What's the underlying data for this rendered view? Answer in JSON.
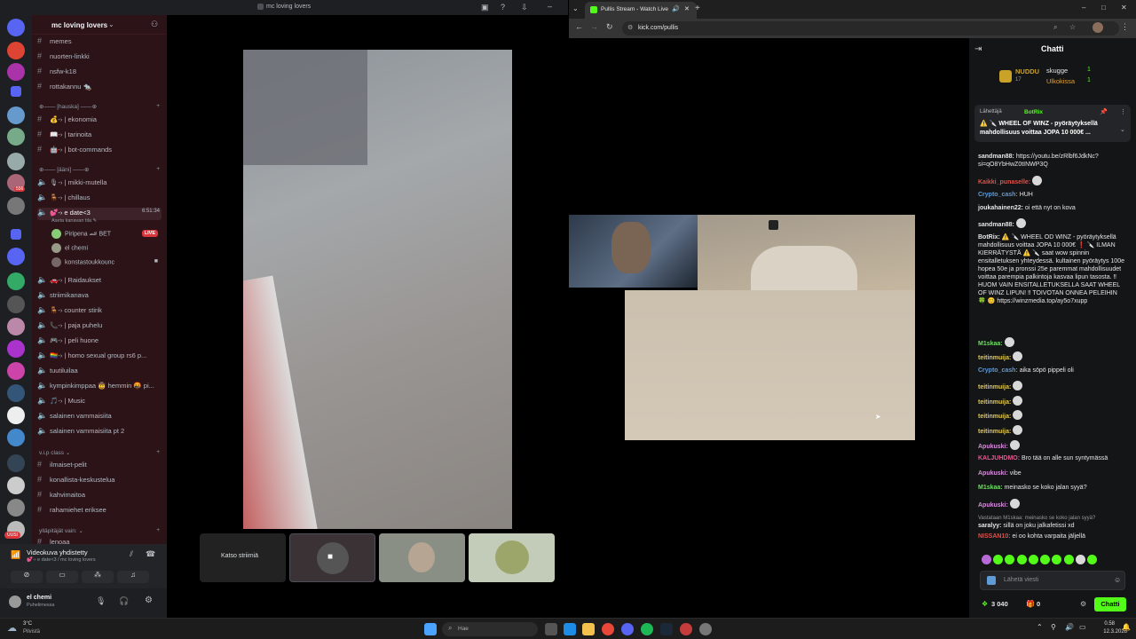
{
  "discord": {
    "window_title": "mc loving lovers",
    "server_name": "mc loving lovers",
    "channels_top": [
      "memes",
      "nuorten-linkki",
      "nsfw-k18",
      "rottakannu 🐀"
    ],
    "category_hauska": "⊕—— [hauska] ——⊕",
    "channels_hauska": [
      "💰-› | ekonomia",
      "📖-› | tarinoita",
      "🤖-› | bot-commands"
    ],
    "category_aani": "⊕—— [ääni] ——⊕",
    "voice_channels_a": [
      "🎙-› | mikki-mutella",
      "🪑-› | chillaus",
      "💕-› e date<3"
    ],
    "active_voice_timer": "6:51:34",
    "active_voice_status": "Aseta kanavan tila ✎",
    "voice_users": [
      "Piripena 🏎 BET",
      "el chemi",
      "konstastoukkounc"
    ],
    "live_label": "LIVE",
    "voice_channels_b": [
      "🚗-› | Raidaukset",
      "striimikanava",
      "🪑-› counter stirik",
      "📞-› | paja puhelu",
      "🎮-› | peli huone",
      "🏳‍🌈-› | homo sexual group rs6 p...",
      "tuutiluilaa",
      "kympinkimppaa 🤠 hemmin 🤬 pi...",
      "🎵-› | Music",
      "salainen vammaisiita",
      "salainen vammaisiita pt 2"
    ],
    "category_vip": "v.i.p class ⌄",
    "channels_vip": [
      "ilmaiset-pelit",
      "konallista-keskustelua",
      "kahvimaitoa",
      "rahamiehet eriksee"
    ],
    "category_yllap": "ylläpitäjät vain: ⌄",
    "channel_last": "lenoaa",
    "new_badge": "UUSI",
    "voice_connected": "Videokuva yhdistetty",
    "voice_connected_sub": "💕-› e date<3 / mc loving lovers",
    "user_name": "el chemi",
    "user_status": "Puhelimessa",
    "watch_stream": "Katso striimiä",
    "server_badges": [
      "556",
      "49",
      "28"
    ]
  },
  "browser": {
    "tab_title": "Pullis Stream - Watch Live",
    "url": "kick.com/pullis",
    "chat_title": "Chatti",
    "leaderboard": [
      {
        "name": "NUDDU",
        "count": "17"
      },
      {
        "name": "skugge",
        "count": "1"
      },
      {
        "name": "Ulkokissa",
        "count": "1"
      }
    ],
    "pinned_label": "Lähettäjä",
    "pinned_by": "BotRix",
    "pinned_text": "⚠️ 🔪 WHEEL OF WINZ - pyöräytyksellä mahdollisuus voittaa JOPA 10 000€ ...",
    "messages": [
      {
        "user": "sandman88:",
        "text": "https://youtu.be/zRlbf6JdkNc?si=qO8YbHwZ0tINWP3Q",
        "color": "#e6e6e6"
      },
      {
        "user": "Kaikki_punaselle:",
        "text": "",
        "color": "#e0504a"
      },
      {
        "user": "Crypto_cash:",
        "text": "HUH",
        "color": "#5f9bd6"
      },
      {
        "user": "joukahainen22:",
        "text": "oi että nyt on kova",
        "color": "#e6e6e6"
      },
      {
        "user": "sandman88:",
        "text": "",
        "color": "#e6e6e6"
      },
      {
        "user": "BotRix:",
        "text": "⚠️ 🔪 WHEEL OD WINZ - pyöräytyksellä mahdollisuus voittaa JOPA 10 000€ ❗ 🔪 ILMAN KIERRÄTYSTÄ ⚠️ 🔪 saat wow spinnin ensitalletuksen yhteydessä. kultainen pyöräytys 100e hopea 50e ja pronssi 25e paremmat mahdollisuudet voittaa parempia palkintoja kasvaa lipun tasosta. ‼ HUOM VAIN ENSITALLETUKSELLA SAAT WHEEL OF WINZ LIPUN! ‼ TOIVOTAN ONNEA PELEIHIN 🍀 😊 https://winzmedia.top/ay5o7xupp",
        "color": "#e6e6e6"
      },
      {
        "user": "M1skaa:",
        "text": "",
        "color": "#75d96b"
      },
      {
        "user": "teitinmuija:",
        "text": "",
        "color": "#e6c94a"
      },
      {
        "user": "Crypto_cash:",
        "text": "aika söpö pippeli oli",
        "color": "#5f9bd6"
      },
      {
        "user": "teitinmuija:",
        "text": "",
        "color": "#e6c94a"
      },
      {
        "user": "teitinmuija:",
        "text": "",
        "color": "#e6c94a"
      },
      {
        "user": "teitinmuija:",
        "text": "",
        "color": "#e6c94a"
      },
      {
        "user": "teitinmuija:",
        "text": "",
        "color": "#e6c94a"
      },
      {
        "user": "Apukuski:",
        "text": "",
        "color": "#d48fd9"
      },
      {
        "user": "KALJUHDMO:",
        "text": "Bro tää on alle sun syntymässä",
        "color": "#e05a8c"
      },
      {
        "user": "Apukuski:",
        "text": "vibe",
        "color": "#d48fd9"
      },
      {
        "user": "M1skaa:",
        "text": "meinasko se koko jalan syyä?",
        "color": "#75d96b"
      },
      {
        "user": "Apukuski:",
        "text": "",
        "color": "#d48fd9"
      },
      {
        "user": "saralyy:",
        "text": "sillä on joku jalkafetissi xd",
        "color": "#e6e6e6"
      },
      {
        "user": "NISSAN10:",
        "text": "ei oo kohta varpaita jäljellä",
        "color": "#e0504a"
      }
    ],
    "reply_to": "Vastataan M1skaa: meinasko se koko jalan syyä?",
    "chat_placeholder": "Lähetä viesti",
    "points": "3 040",
    "gifts": "0",
    "send_button": "Chatti"
  },
  "taskbar": {
    "weather_temp": "3°C",
    "weather_text": "Pilvistä",
    "search_placeholder": "Hae",
    "time": "0.58",
    "date": "12.3.2026"
  }
}
